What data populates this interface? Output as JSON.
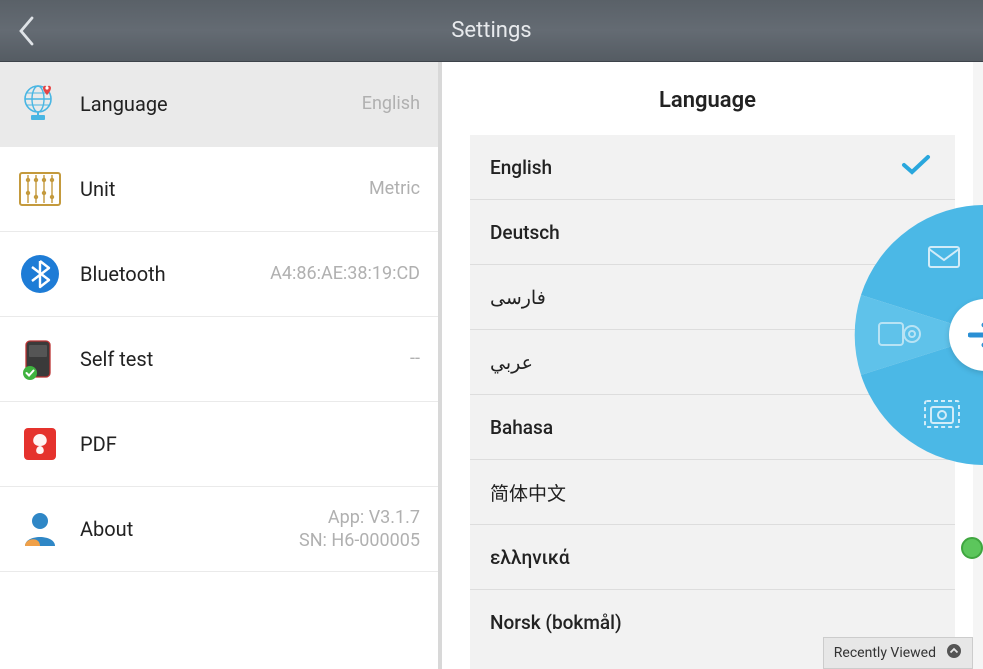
{
  "header": {
    "title": "Settings"
  },
  "sidebar": {
    "items": [
      {
        "label": "Language",
        "value": "English"
      },
      {
        "label": "Unit",
        "value": "Metric"
      },
      {
        "label": "Bluetooth",
        "value": "A4:86:AE:38:19:CD"
      },
      {
        "label": "Self test",
        "value": "--"
      },
      {
        "label": "PDF",
        "value": ""
      },
      {
        "label": "About",
        "value": "App: V3.1.7\nSN: H6-000005"
      }
    ]
  },
  "main": {
    "title": "Language",
    "languages": [
      {
        "label": "English",
        "selected": true
      },
      {
        "label": "Deutsch",
        "selected": false
      },
      {
        "label": "فارسی",
        "selected": false
      },
      {
        "label": "عربي",
        "selected": false
      },
      {
        "label": "Bahasa",
        "selected": false
      },
      {
        "label": "简体中文",
        "selected": false
      },
      {
        "label": "ελληνικά",
        "selected": false
      },
      {
        "label": "Norsk (bokmål)",
        "selected": false
      }
    ]
  },
  "footer": {
    "recently_viewed": "Recently Viewed"
  },
  "radial_icons": [
    "mail-icon",
    "video-icon",
    "camera-icon"
  ]
}
